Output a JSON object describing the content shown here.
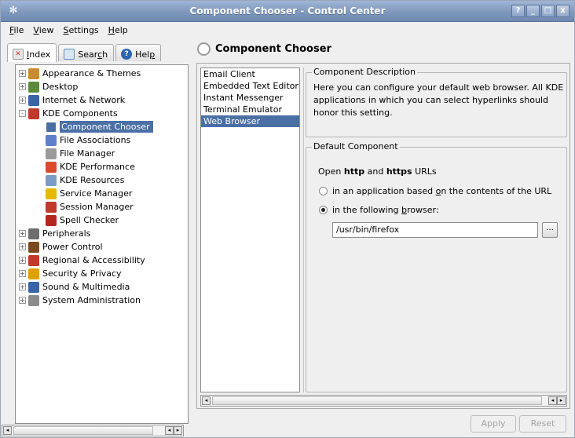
{
  "window": {
    "title": "Component Chooser - Control Center",
    "buttons": {
      "help": "?",
      "minimize": "_",
      "maximize": "□",
      "close": "x"
    }
  },
  "menubar": [
    {
      "first": "F",
      "rest": "ile"
    },
    {
      "first": "V",
      "rest": "iew"
    },
    {
      "first": "S",
      "rest": "ettings"
    },
    {
      "first": "H",
      "rest": "elp"
    }
  ],
  "sidebar": {
    "tabs": [
      {
        "label_start": "",
        "label_ul": "I",
        "label_end": "ndex",
        "icon": "index-icon"
      },
      {
        "label_start": "Sear",
        "label_ul": "c",
        "label_end": "h",
        "icon": "search-icon"
      },
      {
        "label_start": "Hel",
        "label_ul": "p",
        "label_end": "",
        "icon": "help-icon"
      }
    ],
    "tree": [
      {
        "label": "Appearance & Themes",
        "level": 1,
        "expander": "+",
        "icon": "appearance-themes-icon",
        "color": "#c98b2f"
      },
      {
        "label": "Desktop",
        "level": 1,
        "expander": "+",
        "icon": "desktop-icon",
        "color": "#5b8a3a"
      },
      {
        "label": "Internet & Network",
        "level": 1,
        "expander": "+",
        "icon": "internet-network-icon",
        "color": "#3a63a8"
      },
      {
        "label": "KDE Components",
        "level": 1,
        "expander": "-",
        "icon": "kde-components-icon",
        "color": "#c0392b"
      },
      {
        "label": "Component Chooser",
        "level": 2,
        "icon": "component-chooser-icon",
        "color": "#ffffff",
        "selected": true
      },
      {
        "label": "File Associations",
        "level": 2,
        "icon": "file-associations-icon",
        "color": "#5d7fc9"
      },
      {
        "label": "File Manager",
        "level": 2,
        "icon": "file-manager-icon",
        "color": "#9a9a9a"
      },
      {
        "label": "KDE Performance",
        "level": 2,
        "icon": "kde-performance-icon",
        "color": "#d94a2b"
      },
      {
        "label": "KDE Resources",
        "level": 2,
        "icon": "kde-resources-icon",
        "color": "#7a9cc6"
      },
      {
        "label": "Service Manager",
        "level": 2,
        "icon": "service-manager-icon",
        "color": "#e6b800"
      },
      {
        "label": "Session Manager",
        "level": 2,
        "icon": "session-manager-icon",
        "color": "#c0392b"
      },
      {
        "label": "Spell Checker",
        "level": 2,
        "icon": "spell-checker-icon",
        "color": "#b3261e"
      },
      {
        "label": "Peripherals",
        "level": 1,
        "expander": "+",
        "icon": "peripherals-icon",
        "color": "#6d6d6d"
      },
      {
        "label": "Power Control",
        "level": 1,
        "expander": "+",
        "icon": "power-control-icon",
        "color": "#7a4a1e"
      },
      {
        "label": "Regional & Accessibility",
        "level": 1,
        "expander": "+",
        "icon": "regional-accessibility-icon",
        "color": "#c0392b"
      },
      {
        "label": "Security & Privacy",
        "level": 1,
        "expander": "+",
        "icon": "security-privacy-icon",
        "color": "#e0a000"
      },
      {
        "label": "Sound & Multimedia",
        "level": 1,
        "expander": "+",
        "icon": "sound-multimedia-icon",
        "color": "#3a63a8"
      },
      {
        "label": "System Administration",
        "level": 1,
        "expander": "+",
        "icon": "system-administration-icon",
        "color": "#8a8a8a"
      }
    ]
  },
  "module": {
    "title": "Component Chooser",
    "components": [
      "Email Client",
      "Embedded Text Editor",
      "Instant Messenger",
      "Terminal Emulator",
      "Web Browser"
    ],
    "selected_component": "Web Browser",
    "description_group": "Component Description",
    "description": "Here you can configure your default web browser. All KDE applications in which you can select hyperlinks should honor this setting.",
    "default_group": "Default Component",
    "open_prefix": "Open ",
    "open_http": "http",
    "open_and": " and ",
    "open_https": "https",
    "open_suffix": " URLs",
    "radio1": {
      "before": "in an application based ",
      "ul": "o",
      "after": "n the contents of the URL",
      "checked": false
    },
    "radio2": {
      "before": "in the following ",
      "ul": "b",
      "after": "rowser:",
      "checked": true
    },
    "browser_path": "/usr/bin/firefox",
    "browse_label": "...",
    "apply_label": "Apply",
    "reset_label": "Reset"
  }
}
